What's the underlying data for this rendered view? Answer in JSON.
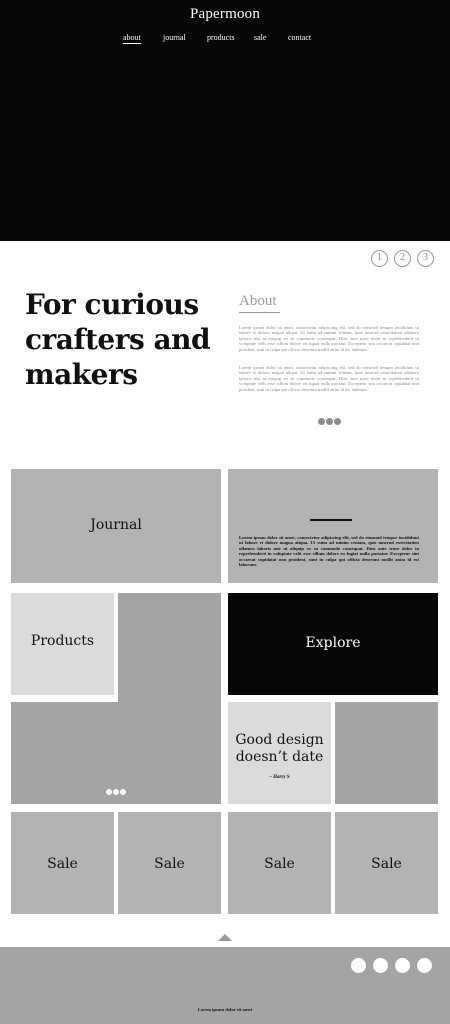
{
  "site": {
    "title": "Papermoon"
  },
  "nav": [
    {
      "label": "about",
      "active": true
    },
    {
      "label": "journal",
      "active": false
    },
    {
      "label": "products",
      "active": false
    },
    {
      "label": "sale",
      "active": false
    },
    {
      "label": "contact",
      "active": false
    }
  ],
  "pagination": [
    "1",
    "2",
    "3"
  ],
  "intro": {
    "headline": "For curious crafters and makers",
    "about_title": "About",
    "paragraphs": [
      "Lorem ipsum dolor sit amet, consectetur adipiscing elit, sed do eiusmod tempor incididunt ut labore et dolore magna aliqua. Ut enim ad minim veniam, quis nostrud exercitation ullamco laboris nisi ut aliquip ex ea commodo consequat. Duis aute irure dolor in reprehenderit in voluptate velit esse cillum dolore eu fugiat nulla pariatur. Excepteur sint occaecat cupidatat non proident, sunt in culpa qui officia deserunt mollit anim id est laborum.",
      "Lorem ipsum dolor sit amet, consectetur adipiscing elit, sed do eiusmod tempor incididunt ut labore et dolore magna aliqua. Ut enim ad minim veniam, quis nostrud exercitation ullamco laboris nisi ut aliquip ex ea commodo consequat. Duis aute irure dolor in reprehenderit in voluptate velit esse cillum dolore eu fugiat nulla pariatur. Excepteur sint occaecat cupidatat non proident, sunt in culpa qui officia deserunt mollit anim id est laborum."
    ]
  },
  "grid": {
    "journal": "Journal",
    "journal_text": "Lorem ipsum dolor sit amet, consectetur adipiscing elit, sed do eiusmod tempor incididunt ut labore et dolore magna aliqua. Ut enim ad minim veniam, quis nostrud exercitation ullamco laboris nisi ut aliquip ex ea commodo consequat. Duis aute irure dolor in reprehenderit in voluptate velit esse cillum dolore eu fugiat nulla pariatur. Excepteur sint occaecat cupidatat non proident, sunt in culpa qui officia deserunt mollit anim id est laborum.",
    "products": "Products",
    "explore": "Explore",
    "quote": "Good design doesn’t date",
    "quote_author": "– Harry S",
    "sale": [
      "Sale",
      "Sale",
      "Sale",
      "Sale"
    ]
  },
  "footer": {
    "text": "Lorem ipsum dolor sit amet"
  },
  "colors": {
    "hero_bg": "#050608",
    "tile_light": "#b3b3b3",
    "tile_pale": "#d9dcdb",
    "tile_mid": "#a4a4a6",
    "tile_black": "#050608",
    "footer_bg": "#a4a4a6"
  }
}
